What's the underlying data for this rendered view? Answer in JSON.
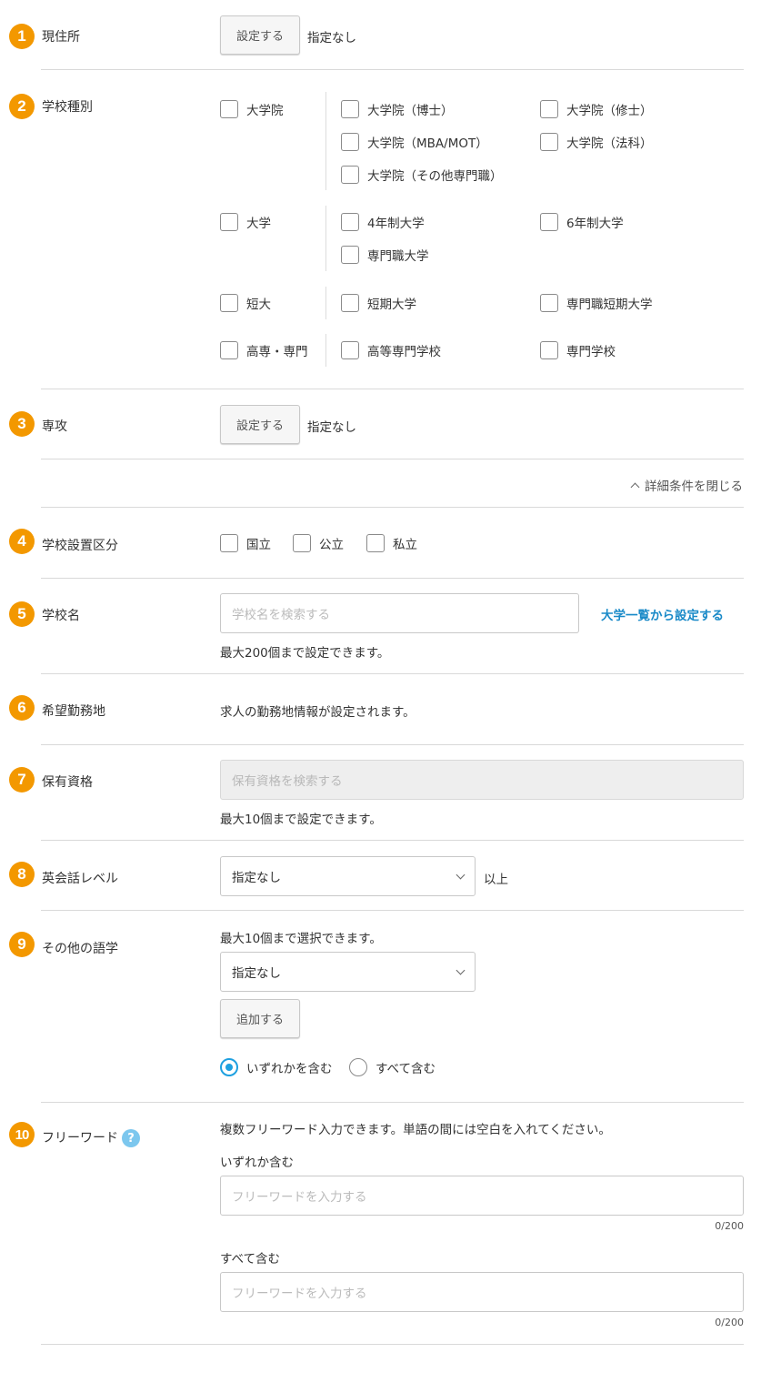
{
  "common": {
    "set_button": "設定する",
    "unspecified": "指定なし",
    "add_button": "追加する"
  },
  "sections": {
    "current_address": {
      "num": "1",
      "label": "現住所"
    },
    "school_type": {
      "num": "2",
      "label": "学校種別"
    },
    "major": {
      "num": "3",
      "label": "専攻"
    },
    "school_category": {
      "num": "4",
      "label": "学校設置区分"
    },
    "school_name": {
      "num": "5",
      "label": "学校名"
    },
    "work_location": {
      "num": "6",
      "label": "希望勤務地"
    },
    "qualifications": {
      "num": "7",
      "label": "保有資格"
    },
    "english_level": {
      "num": "8",
      "label": "英会話レベル"
    },
    "other_languages": {
      "num": "9",
      "label": "その他の語学"
    },
    "free_word": {
      "num": "10",
      "label": "フリーワード"
    }
  },
  "school_type": {
    "grad": {
      "parent": "大学院",
      "children": [
        "大学院（博士）",
        "大学院（修士）",
        "大学院（MBA/MOT）",
        "大学院（法科）",
        "大学院（その他専門職）"
      ]
    },
    "univ": {
      "parent": "大学",
      "children": [
        "4年制大学",
        "6年制大学",
        "専門職大学"
      ]
    },
    "junior": {
      "parent": "短大",
      "children": [
        "短期大学",
        "専門職短期大学"
      ]
    },
    "tech": {
      "parent": "高専・専門",
      "children": [
        "高等専門学校",
        "専門学校"
      ]
    }
  },
  "details_toggle": "詳細条件を閉じる",
  "school_category": {
    "options": [
      "国立",
      "公立",
      "私立"
    ]
  },
  "school_name": {
    "placeholder": "学校名を検索する",
    "link": "大学一覧から設定する",
    "note": "最大200個まで設定できます。"
  },
  "work_location": {
    "text": "求人の勤務地情報が設定されます。"
  },
  "qualifications": {
    "placeholder": "保有資格を検索する",
    "note": "最大10個まで設定できます。"
  },
  "english_level": {
    "selected": "指定なし",
    "suffix": "以上"
  },
  "other_languages": {
    "note": "最大10個まで選択できます。",
    "selected": "指定なし",
    "radio_any": "いずれかを含む",
    "radio_all": "すべて含む"
  },
  "free_word": {
    "help_icon": "?",
    "description": "複数フリーワード入力できます。単語の間には空白を入れてください。",
    "any_label": "いずれか含む",
    "all_label": "すべて含む",
    "placeholder": "フリーワードを入力する",
    "counter_any": "0/200",
    "counter_all": "0/200"
  },
  "colors": {
    "badge": "#f39800",
    "link": "#1a8ac8",
    "radio_active": "#1ea0e0",
    "help": "#7cc7ee"
  }
}
